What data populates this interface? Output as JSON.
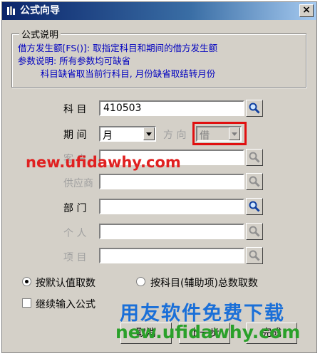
{
  "window": {
    "title": "公式向导",
    "close_symbol": "×"
  },
  "description": {
    "legend": "公式说明",
    "lines": [
      "借方发生额[FS()]: 取指定科目和期间的借方发生额",
      "参数说明: 所有参数均可缺省",
      "        科目缺省取当前行科目, 月份缺省取结转月份"
    ]
  },
  "fields": {
    "subject": {
      "label": "科    目",
      "value": "410503"
    },
    "period": {
      "label": "期    间",
      "value": "月"
    },
    "direction": {
      "label": "方 向",
      "value": "借"
    },
    "customer": {
      "label": "客    户",
      "value": ""
    },
    "supplier": {
      "label": "供应商",
      "value": ""
    },
    "department": {
      "label": "部    门",
      "value": ""
    },
    "person": {
      "label": "个    人",
      "value": ""
    },
    "project": {
      "label": "项    目",
      "value": ""
    }
  },
  "options": {
    "default_value": "按默认值取数",
    "by_subject_total": "按科目(辅助项)总数取数",
    "continue_input": "继续输入公式"
  },
  "buttons": {
    "cancel": "取消",
    "prev": "上一步",
    "finish": "完成"
  },
  "watermark": {
    "top": "new.ufidawhy.com",
    "cn": "用友软件免费下载",
    "bottom": "new.ufidawhy.com"
  },
  "colors": {
    "title_bar": "#0a246a",
    "description_text": "#0000c0",
    "highlight": "#e01010",
    "watermark_red": "#e02020",
    "watermark_blue": "#1a6fd8",
    "watermark_green": "#2aa02a"
  }
}
